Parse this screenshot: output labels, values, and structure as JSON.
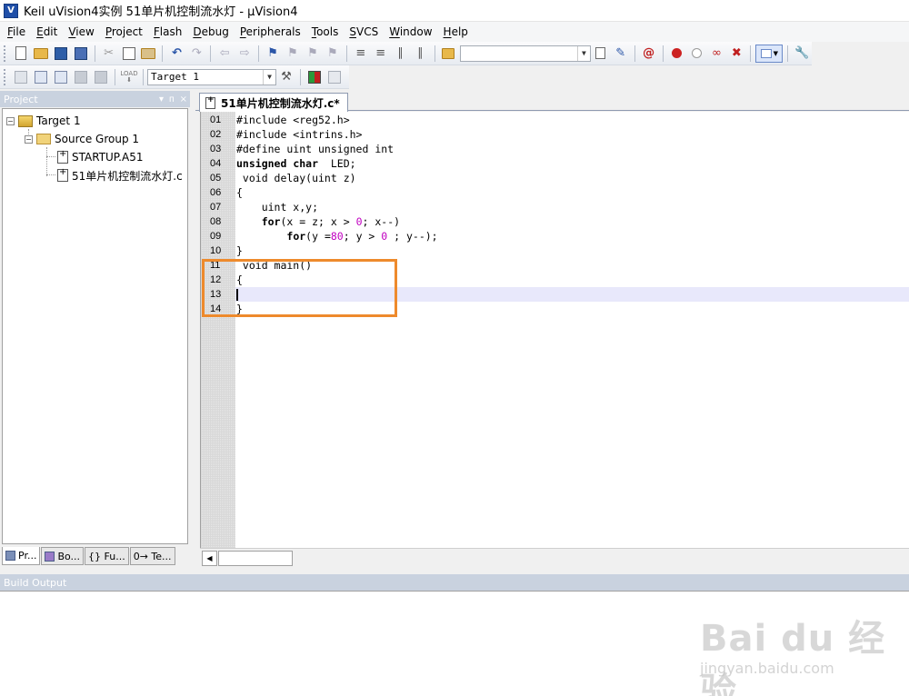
{
  "window": {
    "title": "Keil uVision4实例 51单片机控制流水灯  - µVision4",
    "app_icon_letter": "V"
  },
  "menu": [
    "File",
    "Edit",
    "View",
    "Project",
    "Flash",
    "Debug",
    "Peripherals",
    "Tools",
    "SVCS",
    "Window",
    "Help"
  ],
  "toolbar2": {
    "target_select": "Target 1",
    "load_label": "LOAD"
  },
  "project_panel": {
    "title": "Project",
    "controls": [
      "▾",
      "ᴨ",
      "×"
    ],
    "tree": {
      "target": "Target 1",
      "group": "Source Group 1",
      "files": [
        "STARTUP.A51",
        "51单片机控制流水灯.c"
      ]
    },
    "tabs": [
      "Pr...",
      "Bo...",
      "{} Fu...",
      "0→ Te..."
    ]
  },
  "editor": {
    "tab_label": "51单片机控制流水灯.c*",
    "lines": [
      {
        "n": "01",
        "code": "#include <reg52.h>"
      },
      {
        "n": "02",
        "code": "#include <intrins.h>"
      },
      {
        "n": "03",
        "code": "#define uint unsigned int"
      },
      {
        "n": "04",
        "code": "unsigned char  LED;"
      },
      {
        "n": "05",
        "code": " void delay(uint z)"
      },
      {
        "n": "06",
        "code": "{"
      },
      {
        "n": "07",
        "code": "    uint x,y;"
      },
      {
        "n": "08",
        "code": "    for(x = z; x > 0; x--)"
      },
      {
        "n": "09",
        "code": "        for(y =80; y > 0 ; y--);"
      },
      {
        "n": "10",
        "code": "}"
      },
      {
        "n": "11",
        "code": " void main()"
      },
      {
        "n": "12",
        "code": "{"
      },
      {
        "n": "13",
        "code": ""
      },
      {
        "n": "14",
        "code": "}"
      }
    ],
    "current_line": 13,
    "highlight_color": "#ee8a2c"
  },
  "build_output": {
    "title": "Build Output"
  },
  "watermark": {
    "logo": "Bai du 经验",
    "url": "jingyan.baidu.com"
  }
}
